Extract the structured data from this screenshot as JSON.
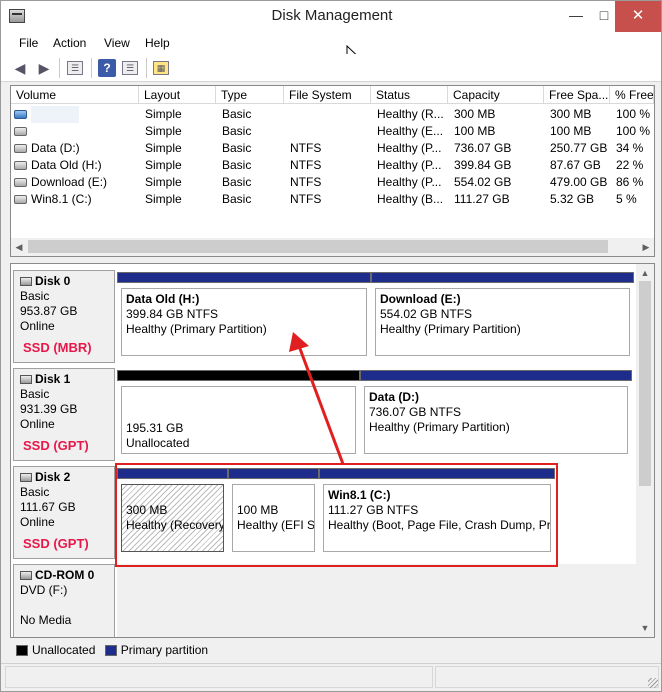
{
  "window": {
    "title": "Disk Management"
  },
  "menu": [
    "File",
    "Action",
    "View",
    "Help"
  ],
  "toolbar": {
    "help_glyph": "?"
  },
  "volumes": {
    "columns": [
      "Volume",
      "Layout",
      "Type",
      "File System",
      "Status",
      "Capacity",
      "Free Spa...",
      "% Free"
    ],
    "rows": [
      [
        "",
        "Simple",
        "Basic",
        "",
        "Healthy (R...",
        "300 MB",
        "300 MB",
        "100 %"
      ],
      [
        "",
        "Simple",
        "Basic",
        "",
        "Healthy (E...",
        "100 MB",
        "100 MB",
        "100 %"
      ],
      [
        "Data (D:)",
        "Simple",
        "Basic",
        "NTFS",
        "Healthy (P...",
        "736.07 GB",
        "250.77 GB",
        "34 %"
      ],
      [
        "Data Old (H:)",
        "Simple",
        "Basic",
        "NTFS",
        "Healthy (P...",
        "399.84 GB",
        "87.67 GB",
        "22 %"
      ],
      [
        "Download (E:)",
        "Simple",
        "Basic",
        "NTFS",
        "Healthy (P...",
        "554.02 GB",
        "479.00 GB",
        "86 %"
      ],
      [
        "Win8.1 (C:)",
        "Simple",
        "Basic",
        "NTFS",
        "Healthy (B...",
        "111.27 GB",
        "5.32 GB",
        "5 %"
      ]
    ]
  },
  "disks": [
    {
      "name": "Disk 0",
      "type": "Basic",
      "size": "953.87 GB",
      "state": "Online",
      "tag": "SSD (MBR)",
      "partitions": [
        {
          "name": "Data Old  (H:)",
          "size": "399.84 GB NTFS",
          "status": "Healthy (Primary Partition)"
        },
        {
          "name": "Download  (E:)",
          "size": "554.02 GB NTFS",
          "status": "Healthy (Primary Partition)"
        }
      ]
    },
    {
      "name": "Disk 1",
      "type": "Basic",
      "size": "931.39 GB",
      "state": "Online",
      "tag": "SSD (GPT)",
      "partitions": [
        {
          "name": "",
          "size": "195.31 GB",
          "status": "Unallocated"
        },
        {
          "name": "Data  (D:)",
          "size": "736.07 GB NTFS",
          "status": "Healthy (Primary Partition)"
        }
      ]
    },
    {
      "name": "Disk 2",
      "type": "Basic",
      "size": "111.67 GB",
      "state": "Online",
      "tag": "SSD (GPT)",
      "partitions": [
        {
          "name": "",
          "size": "300 MB",
          "status": "Healthy (Recovery"
        },
        {
          "name": "",
          "size": "100 MB",
          "status": "Healthy (EFI Sy"
        },
        {
          "name": "Win8.1  (C:)",
          "size": "111.27 GB NTFS",
          "status": "Healthy (Boot, Page File, Crash Dump, Pri"
        }
      ]
    },
    {
      "name": "CD-ROM 0",
      "type": "DVD (F:)",
      "state": "No Media"
    }
  ],
  "legend": {
    "unallocated": "Unallocated",
    "primary": "Primary partition"
  },
  "colors": {
    "primary_bar": "#1e2d8c",
    "unallocated_bar": "#000000",
    "ssd_tag": "#e8174a",
    "annotation": "#e02020"
  }
}
